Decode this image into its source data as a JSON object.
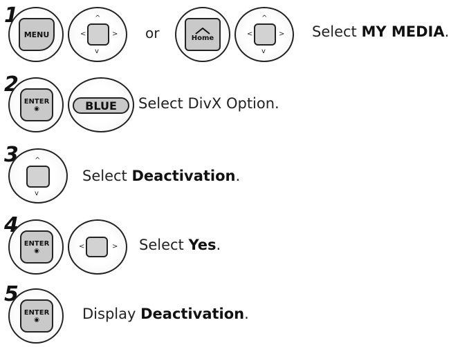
{
  "steps": [
    {
      "number": "1",
      "buttons": [
        "MENU",
        "Home"
      ],
      "or_text": "or",
      "instruction": {
        "prefix": "Select ",
        "bold": "MY MEDIA",
        "suffix": "."
      }
    },
    {
      "number": "2",
      "buttons": [
        "ENTER",
        "BLUE"
      ],
      "instruction": {
        "prefix": "Select DivX Option.",
        "bold": "",
        "suffix": ""
      }
    },
    {
      "number": "3",
      "buttons": [],
      "instruction": {
        "prefix": "Select ",
        "bold": "Deactivation",
        "suffix": "."
      }
    },
    {
      "number": "4",
      "buttons": [
        "ENTER"
      ],
      "instruction": {
        "prefix": "Select ",
        "bold": "Yes",
        "suffix": "."
      }
    },
    {
      "number": "5",
      "buttons": [
        "ENTER"
      ],
      "instruction": {
        "prefix": "Display ",
        "bold": "Deactivation",
        "suffix": "."
      }
    }
  ],
  "icons": {
    "dpad": "navigation-pad-icon",
    "enter_dot": "enter-dot-icon",
    "home_roof": "home-roof-icon"
  }
}
